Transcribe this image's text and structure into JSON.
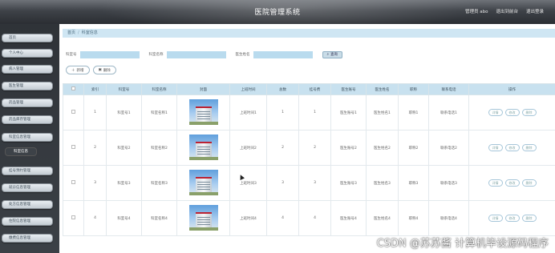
{
  "header": {
    "title": "医院管理系统",
    "user_text": "管理员 abo",
    "back_home": "退出到前台",
    "logout": "退出登录"
  },
  "sidebar": {
    "items": [
      {
        "label": "首页"
      },
      {
        "label": "个人中心"
      },
      {
        "label": "病人管理"
      },
      {
        "label": "医生管理"
      },
      {
        "label": "药品管理"
      },
      {
        "label": "药品库存管理"
      },
      {
        "label": "科室信息管理"
      },
      {
        "label": "科室信息",
        "active": true
      },
      {
        "label": "挂号预约管理"
      },
      {
        "label": "就诊信息管理"
      },
      {
        "label": "处方信息管理"
      },
      {
        "label": "住院信息管理"
      },
      {
        "label": "缴费信息管理"
      }
    ]
  },
  "breadcrumb": {
    "home": "首页",
    "current": "科室信息"
  },
  "search": {
    "fields": [
      {
        "label": "科室号",
        "placeholder": ""
      },
      {
        "label": "科室名称",
        "placeholder": ""
      },
      {
        "label": "医生姓名",
        "placeholder": ""
      }
    ],
    "button": "查询"
  },
  "actions": {
    "add": "新增",
    "delete": "删除"
  },
  "table": {
    "headers": [
      "",
      "索引",
      "科室号",
      "科室名称",
      "封面",
      "上班时间",
      "总数",
      "挂号费",
      "医生账号",
      "医生姓名",
      "职称",
      "联系电话",
      "操作"
    ],
    "rows": [
      {
        "idx": "1",
        "dept_no": "科室号1",
        "dept_name": "科室名称1",
        "time": "上班时间1",
        "total": "1",
        "fee": "1",
        "doc_acc": "医生账号1",
        "doc_name": "医生姓名1",
        "title": "职称1",
        "phone": "联系电话1"
      },
      {
        "idx": "2",
        "dept_no": "科室号2",
        "dept_name": "科室名称2",
        "time": "上班时间2",
        "total": "2",
        "fee": "2",
        "doc_acc": "医生账号2",
        "doc_name": "医生姓名2",
        "title": "职称2",
        "phone": "联系电话2"
      },
      {
        "idx": "3",
        "dept_no": "科室号3",
        "dept_name": "科室名称3",
        "time": "上班时间3",
        "total": "3",
        "fee": "3",
        "doc_acc": "医生账号3",
        "doc_name": "医生姓名3",
        "title": "职称3",
        "phone": "联系电话3"
      },
      {
        "idx": "4",
        "dept_no": "科室号4",
        "dept_name": "科室名称4",
        "time": "上班时间4",
        "total": "4",
        "fee": "4",
        "doc_acc": "医生账号4",
        "doc_name": "医生姓名4",
        "title": "职称4",
        "phone": "联系电话4"
      }
    ],
    "op_labels": {
      "view": "详情",
      "edit": "修改",
      "delete": "删除"
    }
  },
  "watermark": "CSDN @苏苏酱    计算机毕设源码程序",
  "colors": {
    "header_bg": "#3e4248",
    "accent": "#c8e1ef",
    "input_bg": "#b9dbee"
  }
}
